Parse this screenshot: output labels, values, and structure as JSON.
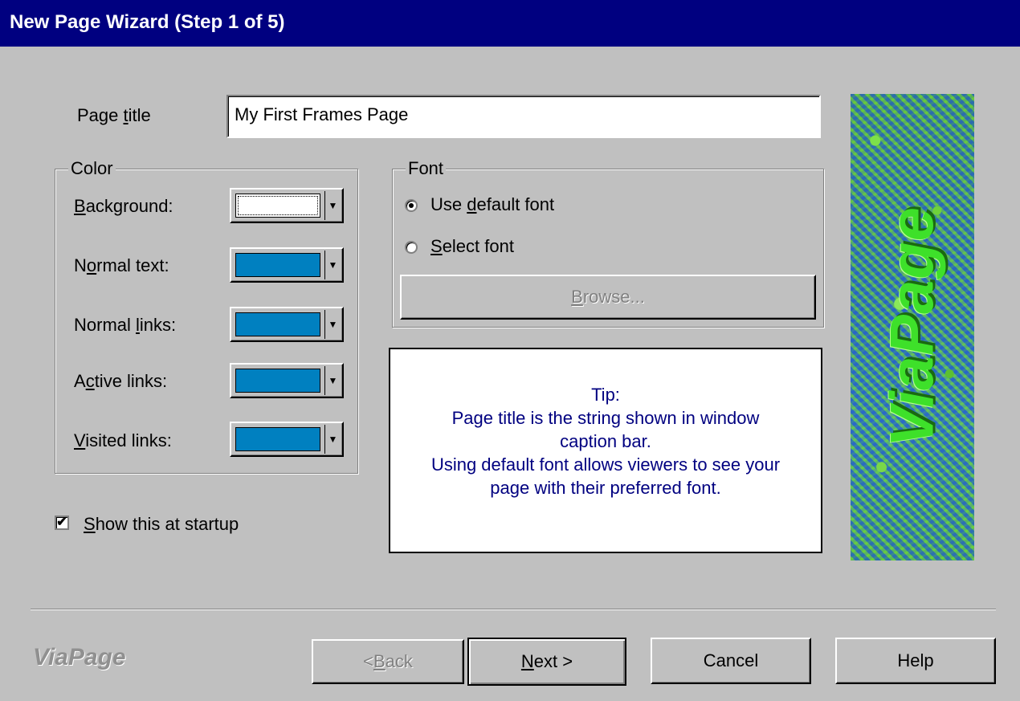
{
  "window": {
    "title": "New Page Wizard (Step 1 of 5)"
  },
  "page_title": {
    "label_pre": "Page ",
    "label_key": "t",
    "label_post": "itle",
    "value": "My First Frames Page"
  },
  "color_group": {
    "title": "Color",
    "rows": [
      {
        "pre": "",
        "key": "B",
        "post": "ackground:",
        "color": "#ffffff"
      },
      {
        "pre": "N",
        "key": "o",
        "post": "rmal text:",
        "color": "#0080c0"
      },
      {
        "pre": "Normal ",
        "key": "l",
        "post": "inks:",
        "color": "#0080c0"
      },
      {
        "pre": "A",
        "key": "c",
        "post": "tive links:",
        "color": "#0080c0"
      },
      {
        "pre": "",
        "key": "V",
        "post": "isited links:",
        "color": "#0080c0"
      }
    ]
  },
  "font_group": {
    "title": "Font",
    "default_pre": "Use ",
    "default_key": "d",
    "default_post": "efault font",
    "select_pre": "",
    "select_key": "S",
    "select_post": "elect font",
    "selected": "default",
    "browse_key": "B",
    "browse_post": "rowse..."
  },
  "tip": {
    "lines": [
      "Tip:",
      "Page title is the string shown in window",
      "caption bar.",
      "Using default font allows viewers to see your",
      "page with their preferred font."
    ]
  },
  "startup": {
    "checked": true,
    "pre": "",
    "key": "S",
    "post": "how this at startup",
    "mark": "✔"
  },
  "banner": {
    "text": "ViaPage"
  },
  "logo": "ViaPage",
  "buttons": {
    "back_pre": "< ",
    "back_key": "B",
    "back_post": "ack",
    "next_key": "N",
    "next_post": "ext >",
    "cancel": "Cancel",
    "help": "Help"
  },
  "icons": {
    "dropdown": "▼"
  }
}
